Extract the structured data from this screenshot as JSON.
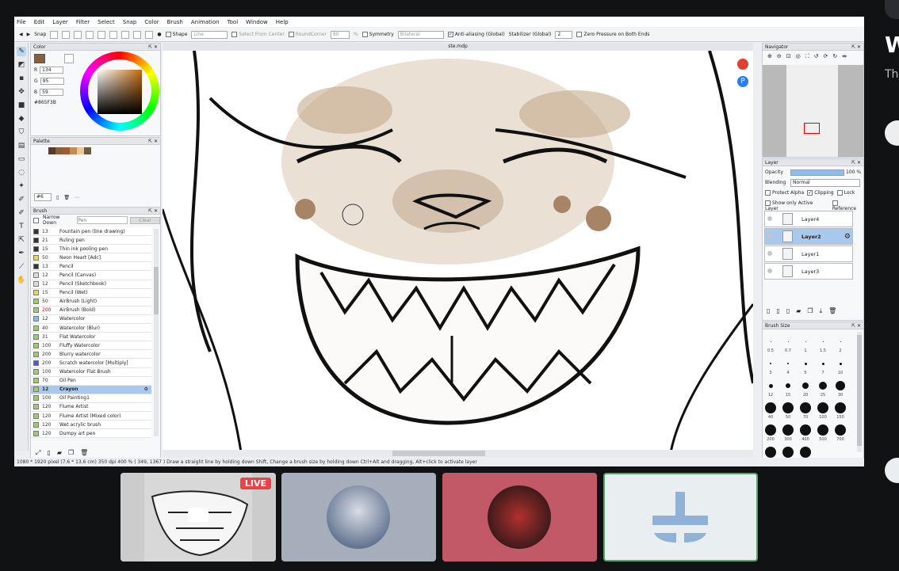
{
  "menu": [
    "File",
    "Edit",
    "Layer",
    "Filter",
    "Select",
    "Snap",
    "Color",
    "Brush",
    "Animation",
    "Tool",
    "Window",
    "Help"
  ],
  "toolbar": {
    "snap_label": "Snap",
    "shape_label": "Shape",
    "shape_value": "Line",
    "select_from_center": "Select From Center",
    "round_corner": "RoundCorner",
    "round_value": "80",
    "percent": "%",
    "symmetry": "Symmetry",
    "symmetry_value": "Bilateral",
    "antialias": "Anti-aliasing (Global)",
    "stabilizer": "Stabilizer (Global)",
    "stabilizer_value": "2",
    "zero_pressure": "Zero Pressure on Both Ends"
  },
  "color_panel": {
    "title": "Color",
    "r_label": "R",
    "r": "134",
    "g_label": "G",
    "g": "95",
    "b_label": "B",
    "b": "59",
    "hex": "#865F3B",
    "current_color": "#865f3b"
  },
  "palette_panel": {
    "title": "Palette",
    "swatches": [
      "#5a3a2a",
      "#865f3b",
      "#a05a3a",
      "#c48a50",
      "#e6c9a0",
      "#6a5a44"
    ],
    "page": "#6"
  },
  "brush_panel": {
    "title": "Brush",
    "narrow_down": "Narrow Down",
    "narrow_placeholder": "Pen",
    "clear": "Clear",
    "brushes": [
      {
        "size": "13",
        "name": "Fountain pen (line drawing)",
        "color": "#333"
      },
      {
        "size": "21",
        "name": "Ruling pen",
        "color": "#333"
      },
      {
        "size": "15",
        "name": "Thin ink pooling pen",
        "color": "#333"
      },
      {
        "size": "50",
        "name": "Neon Heart [Adc]",
        "color": "#f0e020"
      },
      {
        "size": "13",
        "name": "Pencil",
        "color": "#333"
      },
      {
        "size": "12",
        "name": "Pencil (Canvas)",
        "color": "#ddd"
      },
      {
        "size": "12",
        "name": "Pencil (Sketchbook)",
        "color": "#ddd"
      },
      {
        "size": "15",
        "name": "Pencil (Wet)",
        "color": "#f0e020"
      },
      {
        "size": "50",
        "name": "AirBrush (Light)",
        "color": "#9cd060"
      },
      {
        "size": "200",
        "name": "AirBrush (Bold)",
        "color": "#9cd060"
      },
      {
        "size": "12",
        "name": "Watercolor",
        "color": "#7cc0f0"
      },
      {
        "size": "40",
        "name": "Watercolor (Blur)",
        "color": "#9cd060"
      },
      {
        "size": "31",
        "name": "Flat Watercolor",
        "color": "#9cd060"
      },
      {
        "size": "100",
        "name": "Fluffy Watercolor",
        "color": "#9cd060"
      },
      {
        "size": "200",
        "name": "Blurry watercolor",
        "color": "#9cd060"
      },
      {
        "size": "200",
        "name": "Scratch watercolor [Multiply]",
        "color": "#4060e0"
      },
      {
        "size": "100",
        "name": "Watercolor Flat Brush",
        "color": "#9cd060"
      },
      {
        "size": "70",
        "name": "Oil Pen",
        "color": "#9cd060"
      },
      {
        "size": "12",
        "name": "Crayon",
        "color": "#9cd060"
      },
      {
        "size": "100",
        "name": "Oil Painting1",
        "color": "#9cd060"
      },
      {
        "size": "120",
        "name": "Flume Artist",
        "color": "#9cd060"
      },
      {
        "size": "120",
        "name": "Flume Artist (Mixed color)",
        "color": "#9cd060"
      },
      {
        "size": "120",
        "name": "Wet acrylic brush",
        "color": "#9cd060"
      },
      {
        "size": "120",
        "name": "Dumpy art pen",
        "color": "#9cd060"
      }
    ],
    "selected_index": 18
  },
  "canvas": {
    "tab_title": "ste.mdp"
  },
  "navigator": {
    "title": "Navigator"
  },
  "layer_panel": {
    "title": "Layer",
    "opacity_label": "Opacity",
    "opacity_value": "100 %",
    "opacity_fraction": 1.0,
    "blending_label": "Blending",
    "blending_value": "Normal",
    "protect_alpha": "Protect Alpha",
    "clipping": "Clipping",
    "lock": "Lock",
    "show_only_active": "Show only Active Layer",
    "reference": "Reference",
    "layers": [
      {
        "name": "Layer4",
        "selected": false
      },
      {
        "name": "Layer2",
        "selected": true
      },
      {
        "name": "Layer1",
        "selected": false
      },
      {
        "name": "Layer3",
        "selected": false
      }
    ]
  },
  "brush_size_panel": {
    "title": "Brush Size",
    "sizes": [
      "0.5",
      "0.7",
      "1",
      "1.5",
      "2",
      "3",
      "4",
      "5",
      "7",
      "10",
      "12",
      "15",
      "20",
      "25",
      "30",
      "40",
      "50",
      "70",
      "100",
      "150",
      "200",
      "300",
      "400",
      "500",
      "700",
      "1000",
      "1500",
      "2000"
    ]
  },
  "status": {
    "text": "1080 * 1920 pixel   (7.6 * 13.6 cm)   350 dpi   400 %   ( 349, 1367 )   Draw a straight line by holding down Shift, Change a brush size by holding down Ctrl+Alt and dragging, Alt+click to activate layer"
  },
  "stream": {
    "live_label": "LIVE",
    "tile_colors": [
      "#2a2b2e",
      "#a6aebb",
      "#c15a66",
      "#e9eef1"
    ]
  }
}
